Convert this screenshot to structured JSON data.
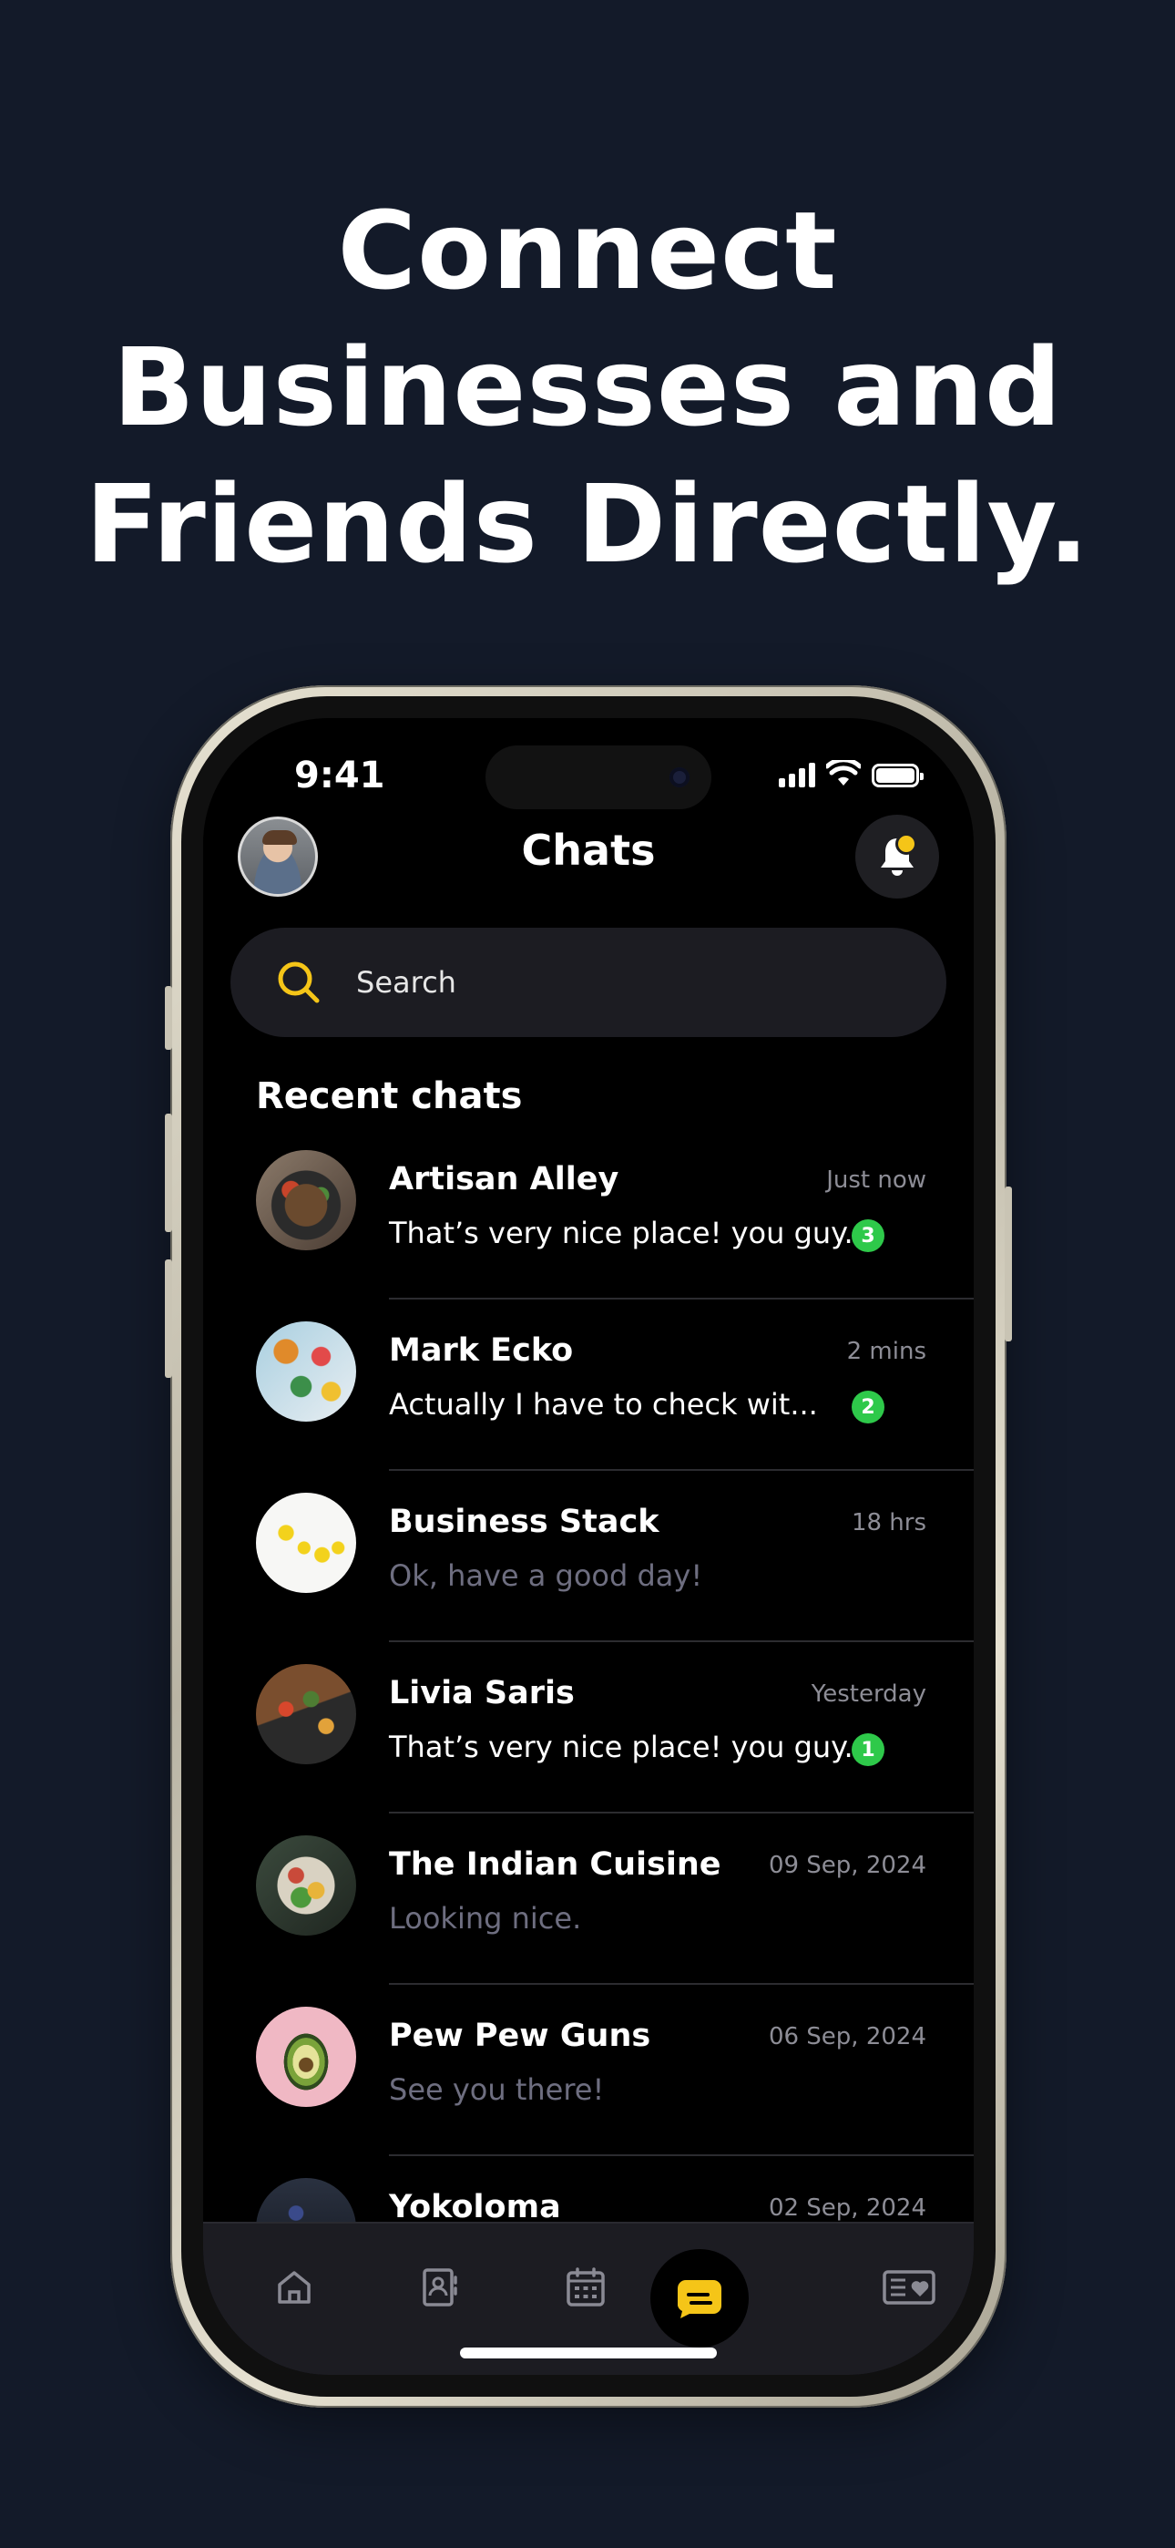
{
  "headline": {
    "line1": "Connect",
    "line2": "Businesses and",
    "line3": "Friends Directly."
  },
  "status_bar": {
    "time": "9:41"
  },
  "header": {
    "title": "Chats"
  },
  "search": {
    "placeholder": "Search"
  },
  "section_title": "Recent chats",
  "colors": {
    "background": "#131a29",
    "accent": "#f5c518",
    "badge": "#2ec94a",
    "muted": "#6e6e80"
  },
  "chats": [
    {
      "name": "Artisan Alley",
      "preview": "That’s very nice place! you guy...",
      "time": "Just now",
      "unread": "3",
      "preview_style": "unread",
      "avatar": "food-bowl"
    },
    {
      "name": "Mark Ecko",
      "preview": "Actually I have to check wit...",
      "time": "2 mins",
      "unread": "2",
      "preview_style": "unread",
      "avatar": "food-table"
    },
    {
      "name": "Business Stack",
      "preview": "Ok, have a good day!",
      "time": "18 hrs",
      "unread": "",
      "preview_style": "read",
      "avatar": "lemons"
    },
    {
      "name": "Livia Saris",
      "preview": "That’s very nice place! you guy...",
      "time": "Yesterday",
      "unread": "1",
      "preview_style": "unread",
      "avatar": "cutting-board"
    },
    {
      "name": "The Indian Cuisine",
      "preview": "Looking nice.",
      "time": "09 Sep, 2024",
      "unread": "",
      "preview_style": "read",
      "avatar": "salad-bowl"
    },
    {
      "name": "Pew Pew Guns",
      "preview": "See you there!",
      "time": "06 Sep, 2024",
      "unread": "",
      "preview_style": "read",
      "avatar": "avocado"
    },
    {
      "name": "Yokoloma",
      "preview": "",
      "time": "02 Sep, 2024",
      "unread": "",
      "preview_style": "read",
      "avatar": "pancakes"
    }
  ],
  "bottom_nav": [
    "home-icon",
    "contacts-book-icon",
    "calendar-icon",
    "chat-bubble-icon",
    "card-heart-icon"
  ]
}
